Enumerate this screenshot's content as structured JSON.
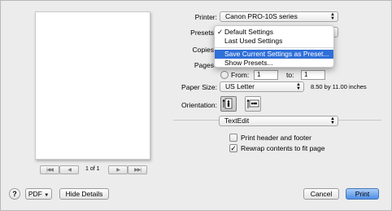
{
  "preview": {
    "page_label": "1 of 1",
    "first_glyph": "|◀◀",
    "prev_glyph": "◀",
    "next_glyph": "▶",
    "last_glyph": "▶▶|"
  },
  "printer": {
    "label": "Printer:",
    "value": "Canon PRO-10S series"
  },
  "presets": {
    "label": "Presets",
    "menu": [
      {
        "label": "Default Settings",
        "checked": true
      },
      {
        "label": "Last Used Settings"
      },
      {
        "label": "Save Current Settings as Preset...",
        "highlighted": true
      },
      {
        "label": "Show Presets..."
      }
    ]
  },
  "copies": {
    "label": "Copies"
  },
  "pages": {
    "label": "Pages",
    "from_label": "From:",
    "from_value": "1",
    "to_label": "to:",
    "to_value": "1"
  },
  "paper_size": {
    "label": "Paper Size:",
    "value": "US Letter",
    "dimensions": "8.50 by 11.00 inches"
  },
  "orientation": {
    "label": "Orientation:"
  },
  "app_section": {
    "value": "TextEdit"
  },
  "options": {
    "print_header_footer": {
      "label": "Print header and footer",
      "checked": false
    },
    "rewrap": {
      "label": "Rewrap contents to fit page",
      "checked": true
    }
  },
  "bottom": {
    "help": "?",
    "pdf": "PDF",
    "hide_details": "Hide Details",
    "cancel": "Cancel",
    "print": "Print"
  },
  "colors": {
    "highlight": "#2f6fd8",
    "default_button": "#4d8ee6"
  }
}
